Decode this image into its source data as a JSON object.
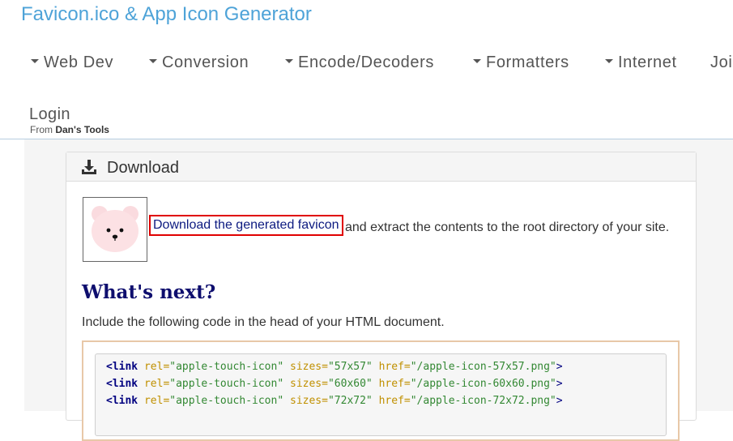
{
  "site": {
    "title": "Favicon.ico & App Icon Generator"
  },
  "nav": {
    "items": [
      "Web Dev",
      "Conversion",
      "Encode/Decoders",
      "Formatters",
      "Internet",
      "Joi"
    ],
    "login": "Login",
    "from_prefix": "From",
    "from_brand": "Dan's Tools"
  },
  "panel": {
    "title": "Download",
    "link_text": "Download the generated favicon",
    "after_link": "and extract the contents to the root directory of your site.",
    "heading": "What's next?",
    "include_text": "Include the following code in the head of your HTML document.",
    "code_lines": [
      {
        "tag": "<link",
        "rel_attr": "rel=",
        "rel_val": "\"apple-touch-icon\"",
        "sizes_attr": "sizes=",
        "sizes_val": "\"57x57\"",
        "href_attr": "href=",
        "href_val": "\"/apple-icon-57x57.png\"",
        "close": ">"
      },
      {
        "tag": "<link",
        "rel_attr": "rel=",
        "rel_val": "\"apple-touch-icon\"",
        "sizes_attr": "sizes=",
        "sizes_val": "\"60x60\"",
        "href_attr": "href=",
        "href_val": "\"/apple-icon-60x60.png\"",
        "close": ">"
      },
      {
        "tag": "<link",
        "rel_attr": "rel=",
        "rel_val": "\"apple-touch-icon\"",
        "sizes_attr": "sizes=",
        "sizes_val": "\"72x72\"",
        "href_attr": "href=",
        "href_val": "\"/apple-icon-72x72.png\"",
        "close": ">"
      }
    ]
  },
  "icons": {
    "download": "download-tray-icon",
    "caret": "caret-down-icon",
    "preview": "bear-favicon-preview"
  },
  "colors": {
    "title": "#4ea3d8",
    "link": "#0c1a80",
    "highlight": "#e00000",
    "heading": "#0e0e6e"
  }
}
